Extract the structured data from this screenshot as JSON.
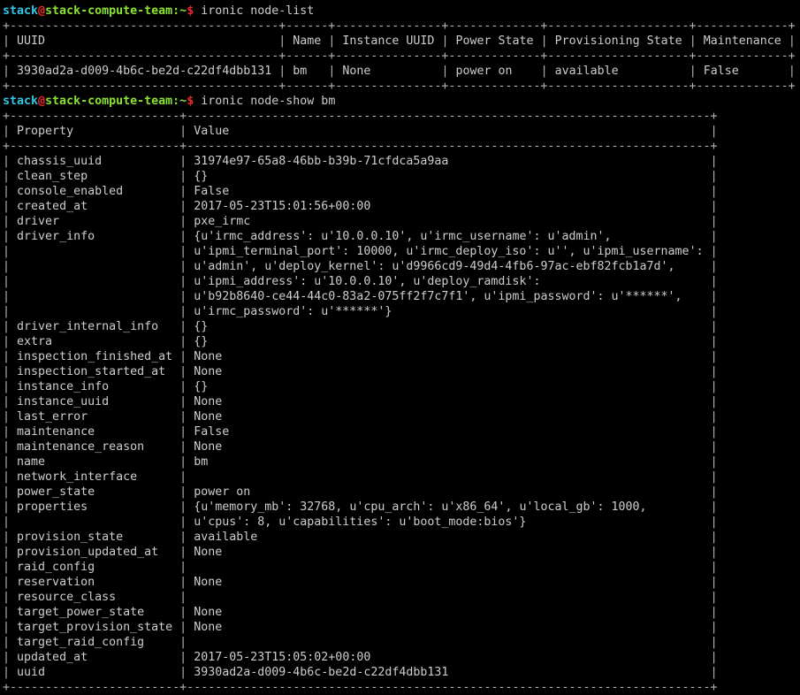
{
  "terminal": {
    "prompt": {
      "user": "stack",
      "at": "@",
      "host": "stack-compute-team",
      "colon": ":",
      "path": "~",
      "dollar": "$"
    },
    "colors": {
      "background": "#000000",
      "text": "#cdcdcd",
      "user": "#34c4e4",
      "host": "#8ae234",
      "accent_red": "#ef2929"
    },
    "commands": [
      {
        "command": "ironic node-list",
        "table": {
          "headers": [
            "UUID",
            "Name",
            "Instance UUID",
            "Power State",
            "Provisioning State",
            "Maintenance"
          ],
          "rows": [
            [
              "3930ad2a-d009-4b6c-be2d-c22df4dbb131",
              "bm",
              "None",
              "power on",
              "available",
              "False"
            ]
          ]
        }
      },
      {
        "command": "ironic node-show bm",
        "table": {
          "headers": [
            "Property",
            "Value"
          ],
          "rows": [
            {
              "property": "chassis_uuid",
              "value": [
                "31974e97-65a8-46bb-b39b-71cfdca5a9aa"
              ]
            },
            {
              "property": "clean_step",
              "value": [
                "{}"
              ]
            },
            {
              "property": "console_enabled",
              "value": [
                "False"
              ]
            },
            {
              "property": "created_at",
              "value": [
                "2017-05-23T15:01:56+00:00"
              ]
            },
            {
              "property": "driver",
              "value": [
                "pxe_irmc"
              ]
            },
            {
              "property": "driver_info",
              "value": [
                "{u'irmc_address': u'10.0.0.10', u'irmc_username': u'admin',",
                "u'ipmi_terminal_port': 10000, u'irmc_deploy_iso': u'', u'ipmi_username':",
                "u'admin', u'deploy_kernel': u'd9966cd9-49d4-4fb6-97ac-ebf82fcb1a7d',",
                "u'ipmi_address': u'10.0.0.10', u'deploy_ramdisk':",
                "u'b92b8640-ce44-44c0-83a2-075ff2f7c7f1', u'ipmi_password': u'******',",
                "u'irmc_password': u'******'}"
              ]
            },
            {
              "property": "driver_internal_info",
              "value": [
                "{}"
              ]
            },
            {
              "property": "extra",
              "value": [
                "{}"
              ]
            },
            {
              "property": "inspection_finished_at",
              "value": [
                "None"
              ]
            },
            {
              "property": "inspection_started_at",
              "value": [
                "None"
              ]
            },
            {
              "property": "instance_info",
              "value": [
                "{}"
              ]
            },
            {
              "property": "instance_uuid",
              "value": [
                "None"
              ]
            },
            {
              "property": "last_error",
              "value": [
                "None"
              ]
            },
            {
              "property": "maintenance",
              "value": [
                "False"
              ]
            },
            {
              "property": "maintenance_reason",
              "value": [
                "None"
              ]
            },
            {
              "property": "name",
              "value": [
                "bm"
              ]
            },
            {
              "property": "network_interface",
              "value": [
                ""
              ]
            },
            {
              "property": "power_state",
              "value": [
                "power on"
              ]
            },
            {
              "property": "properties",
              "value": [
                "{u'memory_mb': 32768, u'cpu_arch': u'x86_64', u'local_gb': 1000,",
                "u'cpus': 8, u'capabilities': u'boot_mode:bios'}"
              ]
            },
            {
              "property": "provision_state",
              "value": [
                "available"
              ]
            },
            {
              "property": "provision_updated_at",
              "value": [
                "None"
              ]
            },
            {
              "property": "raid_config",
              "value": [
                ""
              ]
            },
            {
              "property": "reservation",
              "value": [
                "None"
              ]
            },
            {
              "property": "resource_class",
              "value": [
                ""
              ]
            },
            {
              "property": "target_power_state",
              "value": [
                "None"
              ]
            },
            {
              "property": "target_provision_state",
              "value": [
                "None"
              ]
            },
            {
              "property": "target_raid_config",
              "value": [
                ""
              ]
            },
            {
              "property": "updated_at",
              "value": [
                "2017-05-23T15:05:02+00:00"
              ]
            },
            {
              "property": "uuid",
              "value": [
                "3930ad2a-d009-4b6c-be2d-c22df4dbb131"
              ]
            }
          ]
        }
      }
    ]
  }
}
